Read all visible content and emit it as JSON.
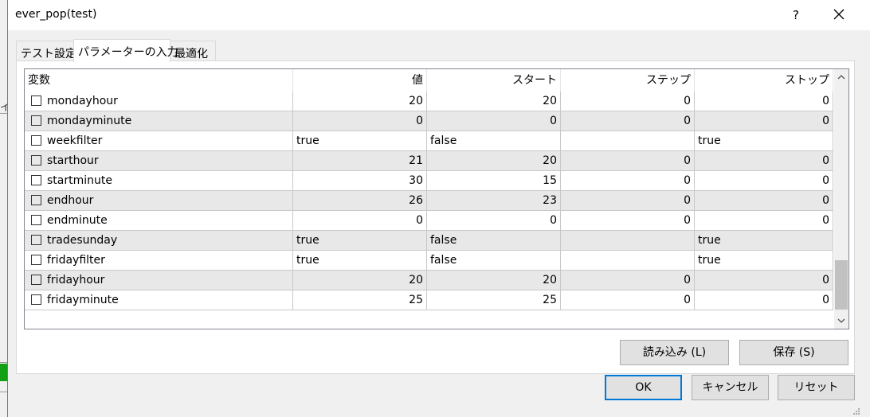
{
  "window": {
    "title": "ever_pop(test)",
    "help_label": "?"
  },
  "background": {
    "glyph": "イ"
  },
  "tabs": [
    {
      "label": "テスト設定"
    },
    {
      "label": "パラメーターの入力"
    },
    {
      "label": "最適化"
    }
  ],
  "table": {
    "columns": [
      "変数",
      "値",
      "スタート",
      "ステップ",
      "ストップ"
    ],
    "rows": [
      {
        "name": "mondayhour",
        "value": "20",
        "start": "20",
        "step": "0",
        "stop": "0"
      },
      {
        "name": "mondayminute",
        "value": "0",
        "start": "0",
        "step": "0",
        "stop": "0"
      },
      {
        "name": "weekfilter",
        "value": "true",
        "start": "false",
        "step": "",
        "stop": "true"
      },
      {
        "name": "starthour",
        "value": "21",
        "start": "20",
        "step": "0",
        "stop": "0"
      },
      {
        "name": "startminute",
        "value": "30",
        "start": "15",
        "step": "0",
        "stop": "0"
      },
      {
        "name": "endhour",
        "value": "26",
        "start": "23",
        "step": "0",
        "stop": "0"
      },
      {
        "name": "endminute",
        "value": "0",
        "start": "0",
        "step": "0",
        "stop": "0"
      },
      {
        "name": "tradesunday",
        "value": "true",
        "start": "false",
        "step": "",
        "stop": "true"
      },
      {
        "name": "fridayfilter",
        "value": "true",
        "start": "false",
        "step": "",
        "stop": "true"
      },
      {
        "name": "fridayhour",
        "value": "20",
        "start": "20",
        "step": "0",
        "stop": "0"
      },
      {
        "name": "fridayminute",
        "value": "25",
        "start": "25",
        "step": "0",
        "stop": "0"
      }
    ]
  },
  "buttons": {
    "load": "読み込み (L)",
    "save": "保存 (S)",
    "ok": "OK",
    "cancel": "キャンセル",
    "reset": "リセット"
  }
}
